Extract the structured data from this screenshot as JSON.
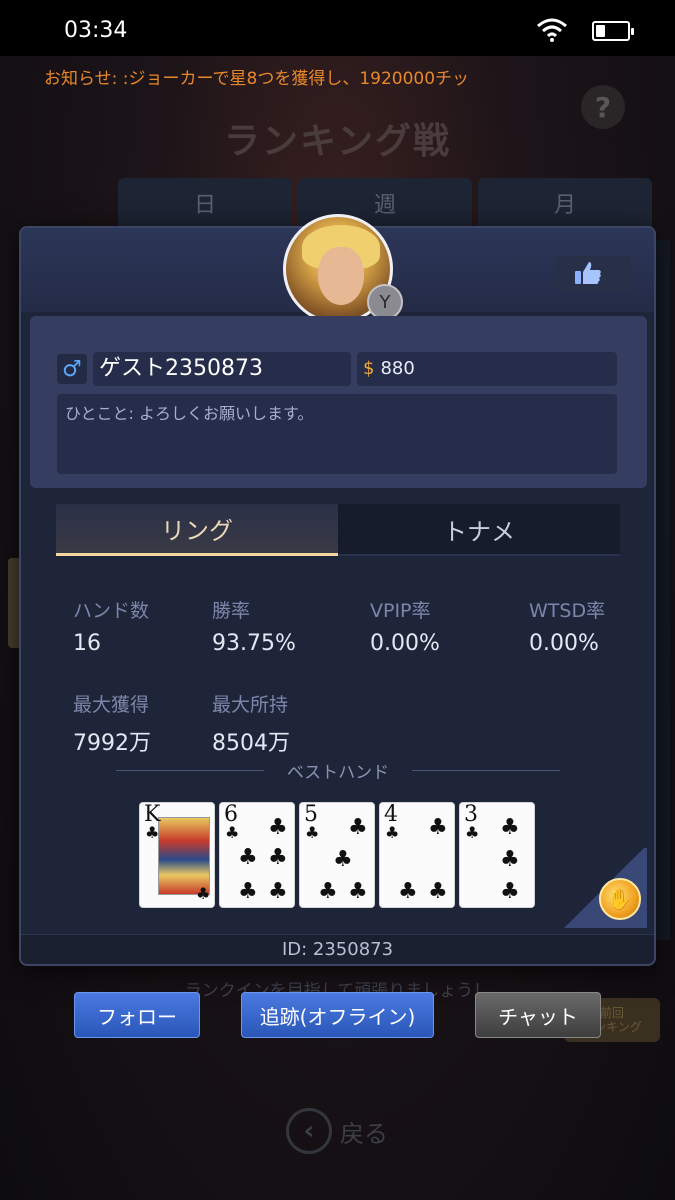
{
  "status_bar": {
    "time": "03:34",
    "battery_level": 0.3
  },
  "notice": "お知らせ: :ジョーカーで星8つを獲得し、1920000チッ",
  "help_label": "?",
  "page_title": "ランキング戦",
  "period_tabs": [
    "日",
    "週",
    "月"
  ],
  "background_text": "ランクインを目指して頑張りましょう！",
  "previous_ranking_label": [
    "前回",
    "ランキング"
  ],
  "back_label": "戻る",
  "profile": {
    "gender_symbol": "♂",
    "name": "ゲスト2350873",
    "coin_symbol": "$",
    "coins": "880",
    "bio": "ひとこと: よろしくお願いします。",
    "badge_symbol": "Y"
  },
  "game_tabs": [
    {
      "label": "リング",
      "active": true
    },
    {
      "label": "トナメ",
      "active": false
    }
  ],
  "stats": [
    {
      "label": "ハンド数",
      "value": "16"
    },
    {
      "label": "勝率",
      "value": "93.75%"
    },
    {
      "label": "VPIP率",
      "value": "0.00%"
    },
    {
      "label": "WTSD率",
      "value": "0.00%"
    },
    {
      "label": "最大獲得",
      "value": "7992万"
    },
    {
      "label": "最大所持",
      "value": "8504万"
    }
  ],
  "best_hand": {
    "label": "ベストハンド",
    "cards": [
      {
        "rank": "K",
        "suit": "♣"
      },
      {
        "rank": "6",
        "suit": "♣"
      },
      {
        "rank": "5",
        "suit": "♣"
      },
      {
        "rank": "4",
        "suit": "♣"
      },
      {
        "rank": "3",
        "suit": "♣"
      }
    ]
  },
  "user_id": "ID: 2350873",
  "buttons": {
    "follow": "フォロー",
    "track": "追跡(オフライン)",
    "chat": "チャット"
  }
}
